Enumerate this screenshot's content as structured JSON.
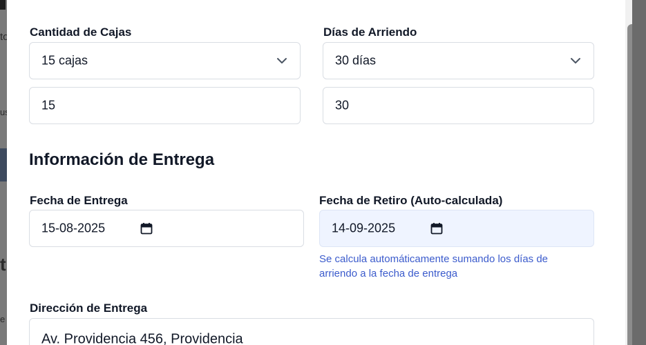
{
  "background": {
    "fragments": [
      "o",
      "to",
      "us",
      "t",
      "e"
    ]
  },
  "form": {
    "boxes": {
      "label": "Cantidad de Cajas",
      "select_value": "15 cajas",
      "input_value": "15"
    },
    "days": {
      "label": "Días de Arriendo",
      "select_value": "30 días",
      "input_value": "30"
    },
    "delivery_section_title": "Información de Entrega",
    "delivery_date": {
      "label": "Fecha de Entrega",
      "value": "15-08-2025"
    },
    "pickup_date": {
      "label": "Fecha de Retiro (Auto-calculada)",
      "value": "14-09-2025",
      "help": "Se calcula automáticamente sumando los días de arriendo a la fecha de entrega"
    },
    "address": {
      "label": "Dirección de Entrega",
      "value": "Av. Providencia 456, Providencia"
    }
  },
  "icons": {
    "select_chevron": "chevron-down-icon",
    "date_picker": "calendar-icon"
  },
  "colors": {
    "help_text": "#3b5bcc",
    "auto_field_bg": "#eff4ff"
  }
}
